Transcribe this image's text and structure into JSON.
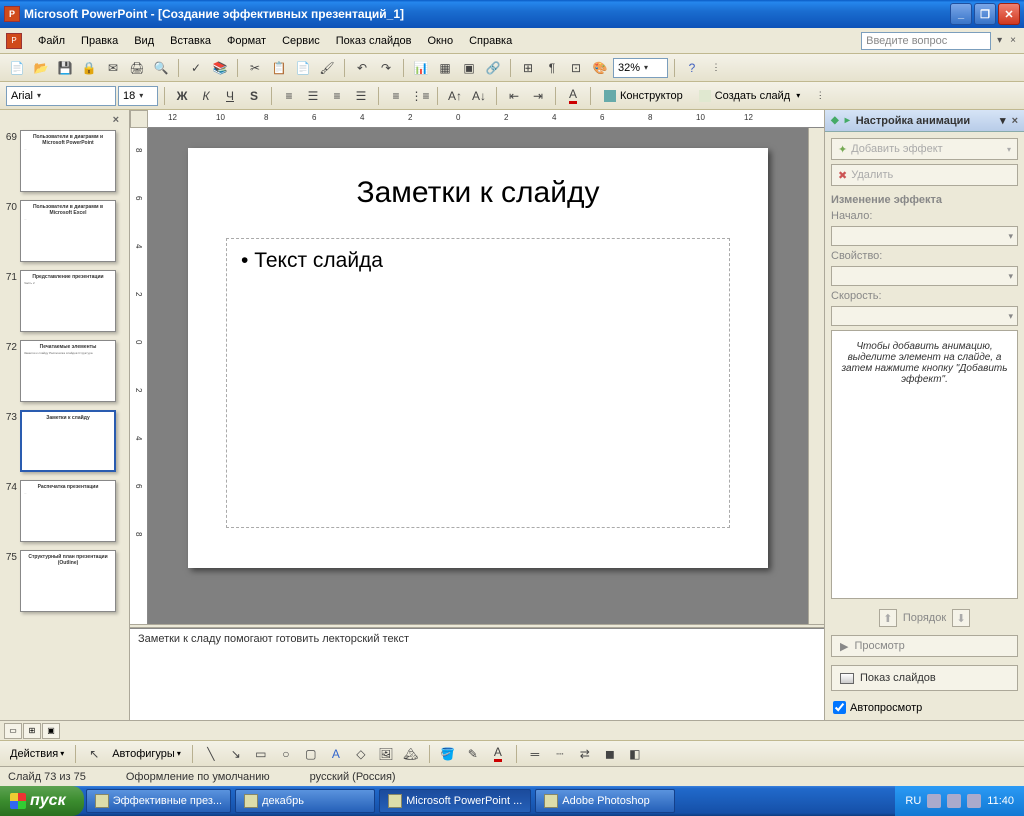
{
  "titlebar": {
    "app": "Microsoft PowerPoint",
    "doc": "[Создание эффективных презентаций_1]"
  },
  "menu": {
    "items": [
      "Файл",
      "Правка",
      "Вид",
      "Вставка",
      "Формат",
      "Сервис",
      "Показ слайдов",
      "Окно",
      "Справка"
    ],
    "help_placeholder": "Введите вопрос"
  },
  "toolbar2": {
    "font": "Arial",
    "size": "18",
    "zoom": "32%",
    "constructor": "Конструктор",
    "new_slide": "Создать слайд"
  },
  "thumbs": [
    {
      "n": 69,
      "title": "Пользователи в диаграмм и Microsoft PowerPoint",
      "body": "..."
    },
    {
      "n": 70,
      "title": "Пользователи в диаграмм в Microsoft Excel",
      "body": "..."
    },
    {
      "n": 71,
      "title": "Представление презентации",
      "body": "Часть 2"
    },
    {
      "n": 72,
      "title": "Печатаемые элементы",
      "body": "Заметки к слайду\nРаспечатка слайдов\nСтруктура"
    },
    {
      "n": 73,
      "title": "Заметки к слайду",
      "body": "",
      "selected": true
    },
    {
      "n": 74,
      "title": "Распечатка презентации",
      "body": "..."
    },
    {
      "n": 75,
      "title": "Структурный план презентации\n(Outline)",
      "body": ""
    }
  ],
  "slide": {
    "title": "Заметки к слайду",
    "bullet1": "Текст слайда"
  },
  "notes": {
    "text": "Заметки к сладу помогают готовить лекторский текст"
  },
  "taskpane": {
    "title": "Настройка анимации",
    "add_effect": "Добавить эффект",
    "delete": "Удалить",
    "change_effect": "Изменение эффекта",
    "start": "Начало:",
    "property": "Свойство:",
    "speed": "Скорость:",
    "info": "Чтобы добавить анимацию, выделите элемент на слайде, а затем нажмите кнопку \"Добавить эффект\".",
    "order": "Порядок",
    "preview": "Просмотр",
    "slideshow": "Показ слайдов",
    "autopreview": "Автопросмотр"
  },
  "ruler_h": [
    "12",
    "10",
    "8",
    "6",
    "4",
    "2",
    "0",
    "2",
    "4",
    "6",
    "8",
    "10",
    "12"
  ],
  "ruler_v": [
    "8",
    "6",
    "4",
    "2",
    "0",
    "2",
    "4",
    "6",
    "8"
  ],
  "drawbar": {
    "actions": "Действия",
    "autoshapes": "Автофигуры"
  },
  "status": {
    "slide": "Слайд 73 из 75",
    "design": "Оформление по умолчанию",
    "lang": "русский (Россия)"
  },
  "taskbar": {
    "start": "пуск",
    "items": [
      {
        "label": "Эффективные през...",
        "icon": "folder"
      },
      {
        "label": "декабрь",
        "icon": "folder"
      },
      {
        "label": "Microsoft PowerPoint ...",
        "icon": "ppt",
        "active": true
      },
      {
        "label": "Adobe Photoshop",
        "icon": "ps"
      }
    ],
    "tray": {
      "lang": "RU",
      "time": "11:40"
    }
  }
}
